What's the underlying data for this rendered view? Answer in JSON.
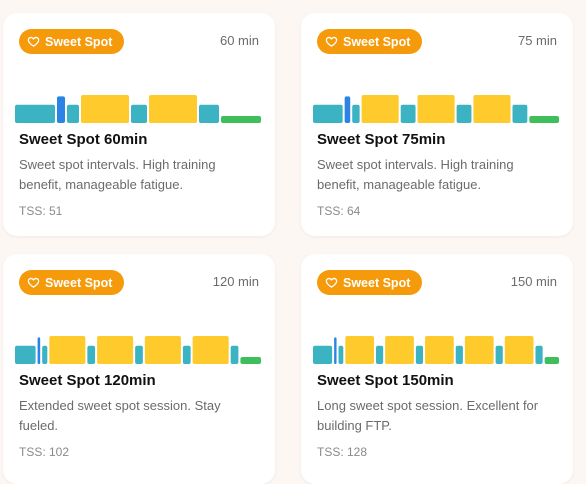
{
  "colors": {
    "badge": "#f59a0a",
    "recovery": "#3bb3c3",
    "sweet_spot": "#ffca2c",
    "burst": "#2b83e6",
    "cooldown": "#3fbf5c"
  },
  "badge_icon": "heart-outline-icon",
  "cards": [
    {
      "badge": "Sweet Spot",
      "duration": "60 min",
      "title": "Sweet Spot 60min",
      "description": "Sweet spot intervals. High training benefit, manageable fatigue.",
      "tss": "TSS: 51",
      "segments": [
        {
          "type": "recovery",
          "dur": 10,
          "level": 0.65
        },
        {
          "type": "burst",
          "dur": 2,
          "level": 0.95
        },
        {
          "type": "recovery",
          "dur": 3,
          "level": 0.65
        },
        {
          "type": "sweet_spot",
          "dur": 12,
          "level": 1.0
        },
        {
          "type": "recovery",
          "dur": 4,
          "level": 0.65
        },
        {
          "type": "sweet_spot",
          "dur": 12,
          "level": 1.0
        },
        {
          "type": "recovery",
          "dur": 5,
          "level": 0.65
        },
        {
          "type": "cooldown",
          "dur": 10,
          "level": 0.25
        }
      ]
    },
    {
      "badge": "Sweet Spot",
      "duration": "75 min",
      "title": "Sweet Spot 75min",
      "description": "Sweet spot intervals. High training benefit, manageable fatigue.",
      "tss": "TSS: 64",
      "segments": [
        {
          "type": "recovery",
          "dur": 8,
          "level": 0.65
        },
        {
          "type": "burst",
          "dur": 1.5,
          "level": 0.95
        },
        {
          "type": "recovery",
          "dur": 2,
          "level": 0.65
        },
        {
          "type": "sweet_spot",
          "dur": 10,
          "level": 1.0
        },
        {
          "type": "recovery",
          "dur": 4,
          "level": 0.65
        },
        {
          "type": "sweet_spot",
          "dur": 10,
          "level": 1.0
        },
        {
          "type": "recovery",
          "dur": 4,
          "level": 0.65
        },
        {
          "type": "sweet_spot",
          "dur": 10,
          "level": 1.0
        },
        {
          "type": "recovery",
          "dur": 4,
          "level": 0.65
        },
        {
          "type": "cooldown",
          "dur": 8,
          "level": 0.25
        }
      ]
    },
    {
      "badge": "Sweet Spot",
      "duration": "120 min",
      "title": "Sweet Spot 120min",
      "description": "Extended sweet spot session. Stay fueled.",
      "tss": "TSS: 102",
      "segments": [
        {
          "type": "recovery",
          "dur": 8,
          "level": 0.65
        },
        {
          "type": "burst",
          "dur": 1,
          "level": 0.95
        },
        {
          "type": "recovery",
          "dur": 2,
          "level": 0.65
        },
        {
          "type": "sweet_spot",
          "dur": 14,
          "level": 1.0
        },
        {
          "type": "recovery",
          "dur": 3,
          "level": 0.65
        },
        {
          "type": "sweet_spot",
          "dur": 14,
          "level": 1.0
        },
        {
          "type": "recovery",
          "dur": 3,
          "level": 0.65
        },
        {
          "type": "sweet_spot",
          "dur": 14,
          "level": 1.0
        },
        {
          "type": "recovery",
          "dur": 3,
          "level": 0.65
        },
        {
          "type": "sweet_spot",
          "dur": 14,
          "level": 1.0
        },
        {
          "type": "recovery",
          "dur": 3,
          "level": 0.65
        },
        {
          "type": "cooldown",
          "dur": 8,
          "level": 0.25
        }
      ]
    },
    {
      "badge": "Sweet Spot",
      "duration": "150 min",
      "title": "Sweet Spot 150min",
      "description": "Long sweet spot session. Excellent for building FTP.",
      "tss": "TSS: 128",
      "segments": [
        {
          "type": "recovery",
          "dur": 8,
          "level": 0.65
        },
        {
          "type": "burst",
          "dur": 1,
          "level": 0.95
        },
        {
          "type": "recovery",
          "dur": 2,
          "level": 0.65
        },
        {
          "type": "sweet_spot",
          "dur": 12,
          "level": 1.0
        },
        {
          "type": "recovery",
          "dur": 3,
          "level": 0.65
        },
        {
          "type": "sweet_spot",
          "dur": 12,
          "level": 1.0
        },
        {
          "type": "recovery",
          "dur": 3,
          "level": 0.65
        },
        {
          "type": "sweet_spot",
          "dur": 12,
          "level": 1.0
        },
        {
          "type": "recovery",
          "dur": 3,
          "level": 0.65
        },
        {
          "type": "sweet_spot",
          "dur": 12,
          "level": 1.0
        },
        {
          "type": "recovery",
          "dur": 3,
          "level": 0.65
        },
        {
          "type": "sweet_spot",
          "dur": 12,
          "level": 1.0
        },
        {
          "type": "recovery",
          "dur": 3,
          "level": 0.65
        },
        {
          "type": "cooldown",
          "dur": 6,
          "level": 0.25
        }
      ]
    }
  ]
}
